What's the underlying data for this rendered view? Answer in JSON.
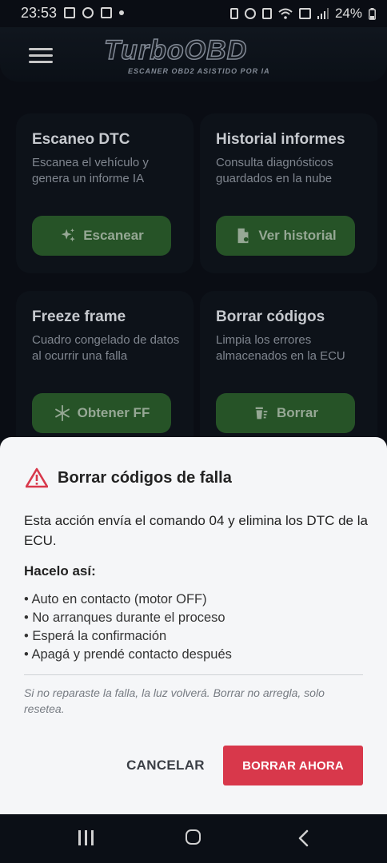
{
  "status_bar": {
    "time": "23:53",
    "battery": "24%",
    "left_icons": [
      "image-icon",
      "link-icon",
      "calendar-icon",
      "dot-icon"
    ],
    "right_icons": [
      "battery-saver-icon",
      "alarm-icon",
      "vibrate-icon",
      "wifi-icon",
      "data-icon",
      "signal-icon",
      "battery-icon"
    ]
  },
  "header": {
    "brand": "TurboOBD",
    "tagline": "ESCANER OBD2 ASISTIDO POR IA"
  },
  "cards": [
    {
      "title": "Escaneo DTC",
      "desc": "Escanea el vehículo y genera un informe IA",
      "button": "Escanear",
      "icon": "sparkles-icon"
    },
    {
      "title": "Historial informes",
      "desc": "Consulta diagnósticos guardados en la nube",
      "button": "Ver historial",
      "icon": "document-icon"
    },
    {
      "title": "Freeze frame",
      "desc": "Cuadro congelado de datos al ocurrir una falla",
      "button": "Obtener FF",
      "icon": "snowflake-icon"
    },
    {
      "title": "Borrar códigos",
      "desc": "Limpia los errores almacenados en la ECU",
      "button": "Borrar",
      "icon": "trash-icon"
    }
  ],
  "dialog": {
    "title": "Borrar códigos de falla",
    "body": "Esta acción envía el comando 04 y elimina los DTC de la ECU.",
    "howto_title": "Hacelo así:",
    "steps": [
      "• Auto en contacto (motor OFF)",
      "• No arranques durante el proceso",
      "• Esperá la confirmación",
      "• Apagá y prendé contacto después"
    ],
    "note": "Si no reparaste la falla, la luz volverá. Borrar no arregla, solo resetea.",
    "cancel_label": "CANCELAR",
    "confirm_label": "BORRAR AHORA",
    "colors": {
      "danger": "#d8384b",
      "button_green": "#2a5b2b"
    }
  }
}
